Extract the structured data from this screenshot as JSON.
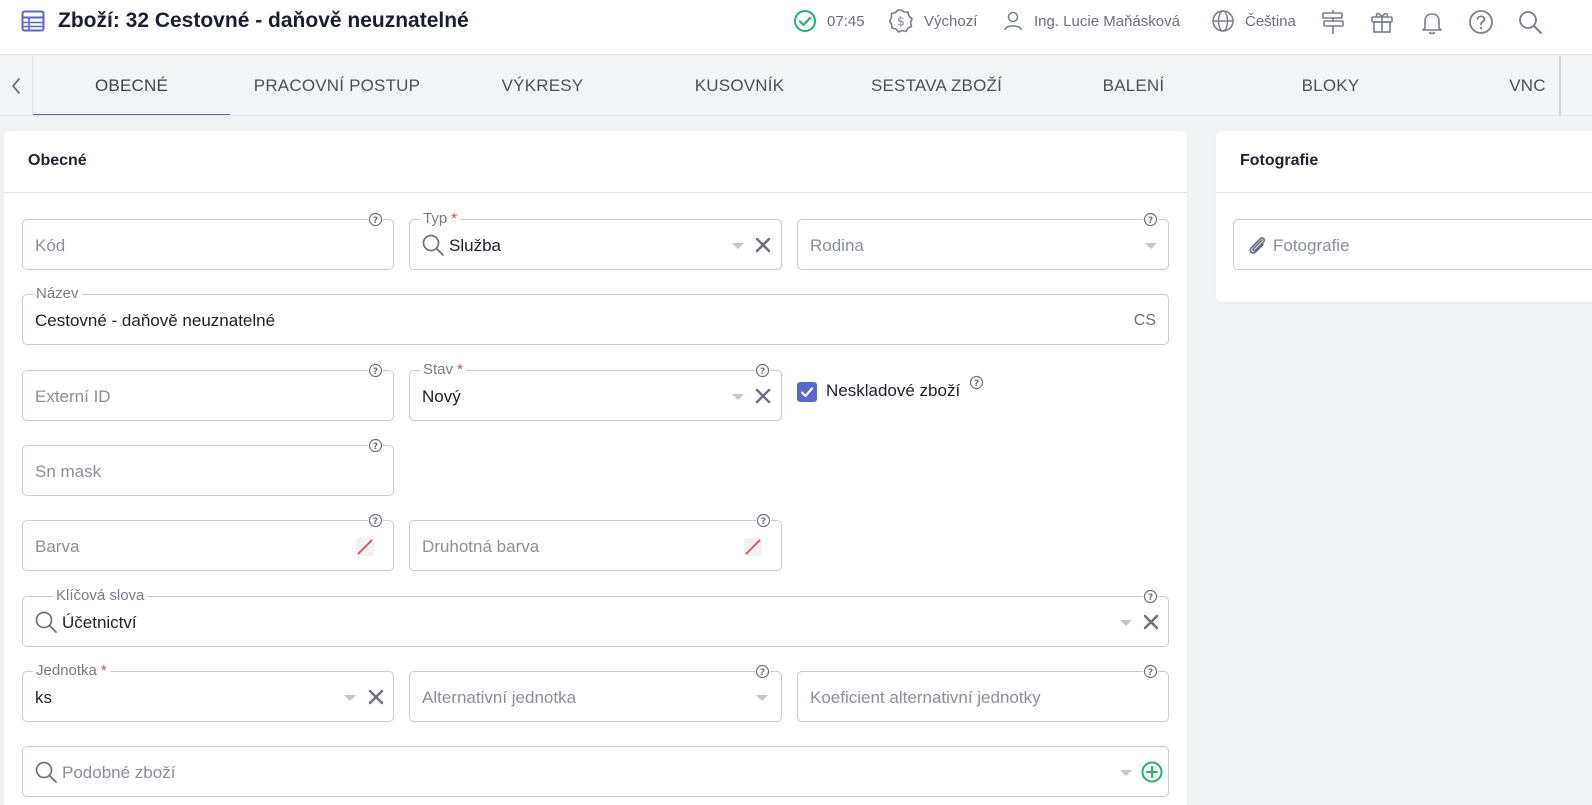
{
  "header": {
    "title": "Zboží: 32 Cestovné - daňově neuznatelné",
    "time": "07:45",
    "currency_profile": "Výchozí",
    "user": "Ing. Lucie Maňásková",
    "language": "Čeština"
  },
  "tabs": [
    {
      "label": "OBECNÉ",
      "active": true
    },
    {
      "label": "PRACOVNÍ POSTUP"
    },
    {
      "label": "VÝKRESY"
    },
    {
      "label": "KUSOVNÍK"
    },
    {
      "label": "SESTAVA ZBOŽÍ"
    },
    {
      "label": "BALENÍ"
    },
    {
      "label": "BLOKY"
    },
    {
      "label": "VNC"
    }
  ],
  "general": {
    "section_title": "Obecné",
    "kod": {
      "placeholder": "Kód"
    },
    "typ": {
      "label": "Typ",
      "value": "Služba"
    },
    "rodina": {
      "placeholder": "Rodina"
    },
    "nazev": {
      "label": "Název",
      "value": "Cestovné - daňově neuznatelné",
      "lang": "CS"
    },
    "externi_id": {
      "placeholder": "Externí ID"
    },
    "stav": {
      "label": "Stav",
      "value": "Nový"
    },
    "neskladove": {
      "label": "Neskladové zboží",
      "checked": true
    },
    "sn_mask": {
      "placeholder": "Sn mask"
    },
    "barva": {
      "placeholder": "Barva"
    },
    "druhotna_barva": {
      "placeholder": "Druhotná barva"
    },
    "klicova_slova": {
      "label": "Klíčová slova",
      "value": "Účetnictví"
    },
    "jednotka": {
      "label": "Jednotka",
      "value": "ks"
    },
    "alt_jednotka": {
      "placeholder": "Alternativní jednotka"
    },
    "koeficient": {
      "placeholder": "Koeficient alternativní jednotky"
    },
    "podobne": {
      "placeholder": "Podobné zboží"
    }
  },
  "photos": {
    "section_title": "Fotografie",
    "field_placeholder": "Fotografie"
  },
  "colors": {
    "accent": "#5b66c9",
    "status_ok": "#1fb36b",
    "add": "#1fb36b",
    "required": "#e0443e"
  }
}
